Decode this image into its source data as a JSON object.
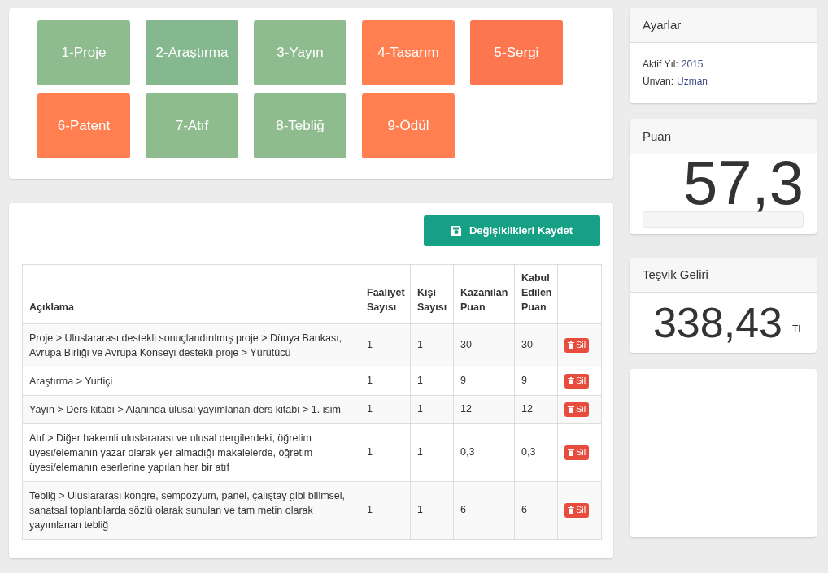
{
  "categories": [
    {
      "label": "1-Proje",
      "color": "#8fbc8f"
    },
    {
      "label": "2-Araştırma",
      "color": "#86b890"
    },
    {
      "label": "3-Yayın",
      "color": "#8fbc8f"
    },
    {
      "label": "4-Tasarım",
      "color": "#ff7f50"
    },
    {
      "label": "5-Sergi",
      "color": "#fc7650"
    },
    {
      "label": "6-Patent",
      "color": "#ff7f50"
    },
    {
      "label": "7-Atıf",
      "color": "#8fbc8f"
    },
    {
      "label": "8-Tebliğ",
      "color": "#8fbc8f"
    },
    {
      "label": "9-Ödül",
      "color": "#ff7f50"
    }
  ],
  "save_button": "Değişiklikleri Kaydet",
  "table": {
    "columns": [
      "Açıklama",
      "Faaliyet Sayısı",
      "Kişi Sayısı",
      "Kazanılan Puan",
      "Kabul Edilen Puan"
    ],
    "rows": [
      {
        "description": "Proje > Uluslararası destekli sonuçlandırılmış proje > Dünya Bankası, Avrupa Birliği ve Avrupa Konseyi destekli proje > Yürütücü",
        "activity_count": "1",
        "person_count": "1",
        "earned": "30",
        "accepted": "30",
        "delete": "Sil"
      },
      {
        "description": "Araştırma > Yurtiçi",
        "activity_count": "1",
        "person_count": "1",
        "earned": "9",
        "accepted": "9",
        "delete": "Sil"
      },
      {
        "description": "Yayın > Ders kitabı > Alanında ulusal yayımlanan ders kitabı > 1. isim",
        "activity_count": "1",
        "person_count": "1",
        "earned": "12",
        "accepted": "12",
        "delete": "Sil"
      },
      {
        "description": "Atıf > Diğer hakemli uluslararası ve ulusal dergilerdeki, öğretim üyesi/elemanın yazar olarak yer almadığı makalelerde, öğretim üyesi/elemanın eserlerine yapılan her bir atıf",
        "activity_count": "1",
        "person_count": "1",
        "earned": "0,3",
        "accepted": "0,3",
        "delete": "Sil"
      },
      {
        "description": "Tebliğ > Uluslararası kongre, sempozyum, panel, çalıştay gibi bilimsel, sanatsal toplantılarda sözlü olarak sunulan ve tam metin olarak yayımlanan tebliğ",
        "activity_count": "1",
        "person_count": "1",
        "earned": "6",
        "accepted": "6",
        "delete": "Sil"
      }
    ]
  },
  "settings": {
    "title": "Ayarlar",
    "items": [
      {
        "label": "Aktif Yıl:",
        "value": "2015"
      },
      {
        "label": "Ünvan:",
        "value": "Uzman"
      }
    ]
  },
  "score": {
    "title": "Puan",
    "value": "57,3",
    "level": 0
  },
  "incentive": {
    "title": "Teşvik Geliri",
    "value": "338,43",
    "unit": "TL"
  }
}
